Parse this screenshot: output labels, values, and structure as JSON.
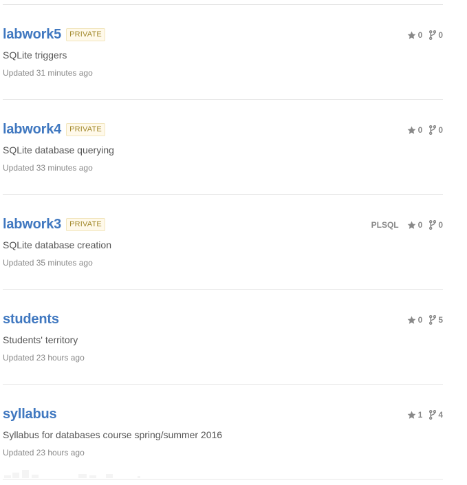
{
  "repos": [
    {
      "name": "labwork5",
      "badge": "PRIVATE",
      "description": "SQLite triggers",
      "updated": "Updated 31 minutes ago",
      "language": "",
      "stars": "0",
      "forks": "0"
    },
    {
      "name": "labwork4",
      "badge": "PRIVATE",
      "description": "SQLite database querying",
      "updated": "Updated 33 minutes ago",
      "language": "",
      "stars": "0",
      "forks": "0"
    },
    {
      "name": "labwork3",
      "badge": "PRIVATE",
      "description": "SQLite database creation",
      "updated": "Updated 35 minutes ago",
      "language": "PLSQL",
      "stars": "0",
      "forks": "0"
    },
    {
      "name": "students",
      "badge": "",
      "description": "Students' territory",
      "updated": "Updated 23 hours ago",
      "language": "",
      "stars": "0",
      "forks": "5"
    },
    {
      "name": "syllabus",
      "badge": "",
      "description": "Syllabus for databases course spring/summer 2016",
      "updated": "Updated 23 hours ago",
      "language": "",
      "stars": "1",
      "forks": "4"
    }
  ],
  "icons": {
    "star": "star-icon",
    "fork": "repo-forked-icon"
  },
  "colors": {
    "link": "#4078c0",
    "badge_text": "#a1882b",
    "badge_bg": "#fff9ea",
    "muted": "#888888"
  }
}
